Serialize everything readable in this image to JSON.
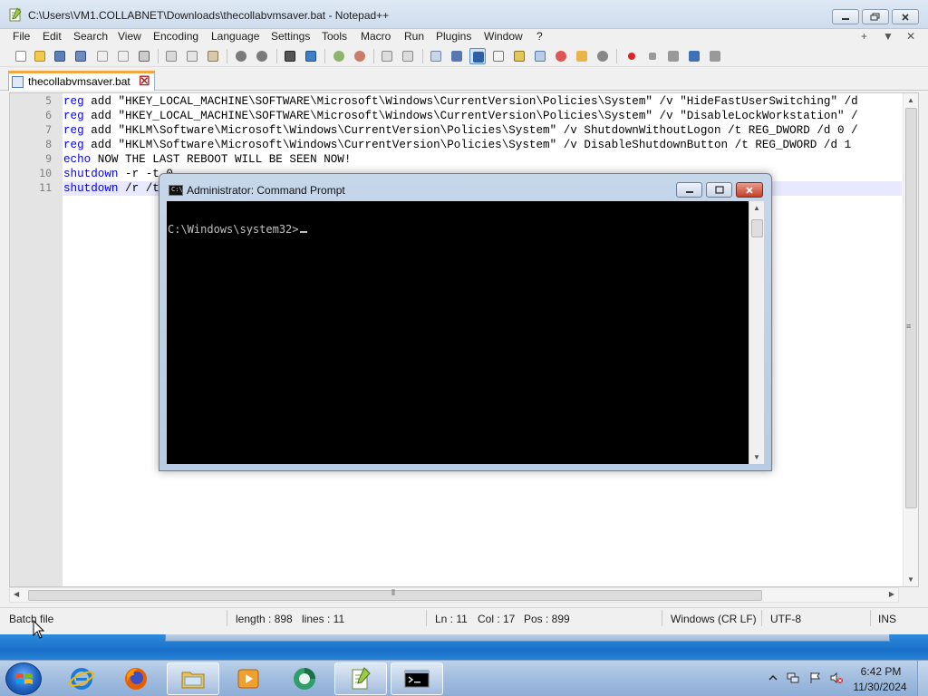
{
  "npp": {
    "title": "C:\\Users\\VM1.COLLABNET\\Downloads\\thecollabvmsaver.bat - Notepad++",
    "menu": [
      "File",
      "Edit",
      "Search",
      "View",
      "Encoding",
      "Language",
      "Settings",
      "Tools",
      "Macro",
      "Run",
      "Plugins",
      "Window",
      "?"
    ],
    "menu_right": [
      "+",
      "▼",
      "✕"
    ],
    "tab_label": "thecollabvmsaver.bat",
    "lines": [
      {
        "no": "5",
        "kw": "reg",
        "rest": " add \"HKEY_LOCAL_MACHINE\\SOFTWARE\\Microsoft\\Windows\\CurrentVersion\\Policies\\System\" /v \"HideFastUserSwitching\" /d"
      },
      {
        "no": "6",
        "kw": "reg",
        "rest": " add \"HKEY_LOCAL_MACHINE\\SOFTWARE\\Microsoft\\Windows\\CurrentVersion\\Policies\\System\" /v \"DisableLockWorkstation\" /"
      },
      {
        "no": "7",
        "kw": "reg",
        "rest": " add \"HKLM\\Software\\Microsoft\\Windows\\CurrentVersion\\Policies\\System\" /v ShutdownWithoutLogon /t REG_DWORD /d 0 /"
      },
      {
        "no": "8",
        "kw": "reg",
        "rest": " add \"HKLM\\Software\\Microsoft\\Windows\\CurrentVersion\\Policies\\System\" /v DisableShutdownButton /t REG_DWORD /d 1"
      },
      {
        "no": "9",
        "kw": "echo",
        "rest": " NOW THE LAST REBOOT WILL BE SEEN NOW!"
      },
      {
        "no": "10",
        "kw": "shutdown",
        "rest": " -r -t 0"
      },
      {
        "no": "11",
        "kw": "shutdown",
        "rest": " /r /t 0"
      }
    ],
    "status": {
      "type": "Batch file",
      "length": "length : 898",
      "lines": "lines : 11",
      "ln": "Ln : 11",
      "col": "Col : 17",
      "pos": "Pos : 899",
      "eol": "Windows (CR LF)",
      "encoding": "UTF-8",
      "mode": "INS"
    }
  },
  "cmd": {
    "title": "Administrator: Command Prompt",
    "icon_text": "C:\\",
    "prompt": "C:\\Windows\\system32>"
  },
  "taskbar": {
    "clock_time": "6:42 PM",
    "clock_date": "11/30/2024",
    "pins": [
      "internet-explorer",
      "firefox",
      "file-explorer",
      "media-player",
      "browser-app",
      "notepad-plus-plus",
      "command-prompt"
    ]
  }
}
